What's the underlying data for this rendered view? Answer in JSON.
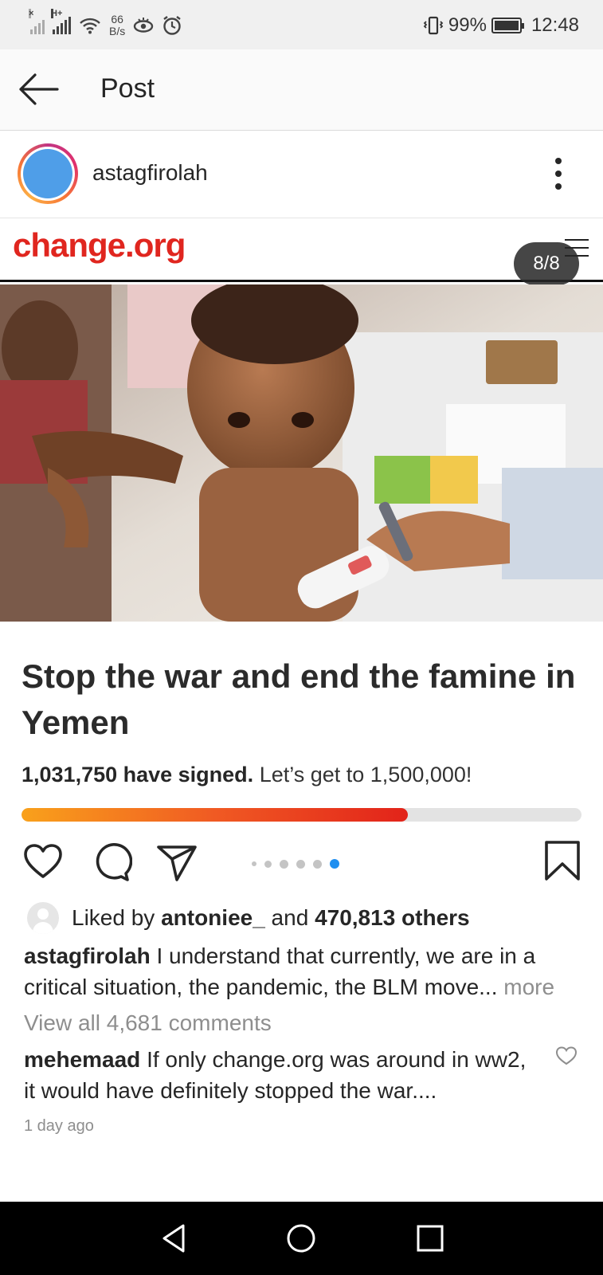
{
  "status_bar": {
    "net_type": "H+",
    "net_speed_value": "66",
    "net_speed_unit": "B/s",
    "battery_percent": "99%",
    "battery_level": 0.99,
    "time": "12:48"
  },
  "header": {
    "title": "Post"
  },
  "post": {
    "author": "astagfirolah",
    "brand": "change.org",
    "carousel_counter": "8/8",
    "petition_title": "Stop the war and end the famine in Yemen",
    "signed_count": "1,031,750 have signed.",
    "signed_goal": " Let’s get to 1,500,000!",
    "progress_fraction": 0.69,
    "carousel_dots_total": 6,
    "carousel_dots_active": 6
  },
  "likes": {
    "prefix": "Liked by ",
    "user": "antoniee_",
    "middle": " and ",
    "others": "470,813 others"
  },
  "caption": {
    "author": "astagfirolah",
    "text": " I understand that currently, we are in a critical situation, the pandemic, the BLM move",
    "ellipsis": "...",
    "more": " more"
  },
  "comments": {
    "view_all": "View all 4,681 comments",
    "first_author": "mehemaad",
    "first_text": " If only change.org was around in ww2, it would have definitely stopped the war....",
    "timestamp": "1 day ago"
  },
  "icons": {
    "back": "arrow-left-icon",
    "more": "vertical-dots-icon",
    "like": "heart-icon",
    "comment": "comment-icon",
    "share": "paper-plane-icon",
    "save": "bookmark-icon"
  },
  "colors": {
    "brand_red": "#e0261f",
    "dot_active": "#1f8ff0",
    "avatar_blue": "#4f9ee8"
  }
}
